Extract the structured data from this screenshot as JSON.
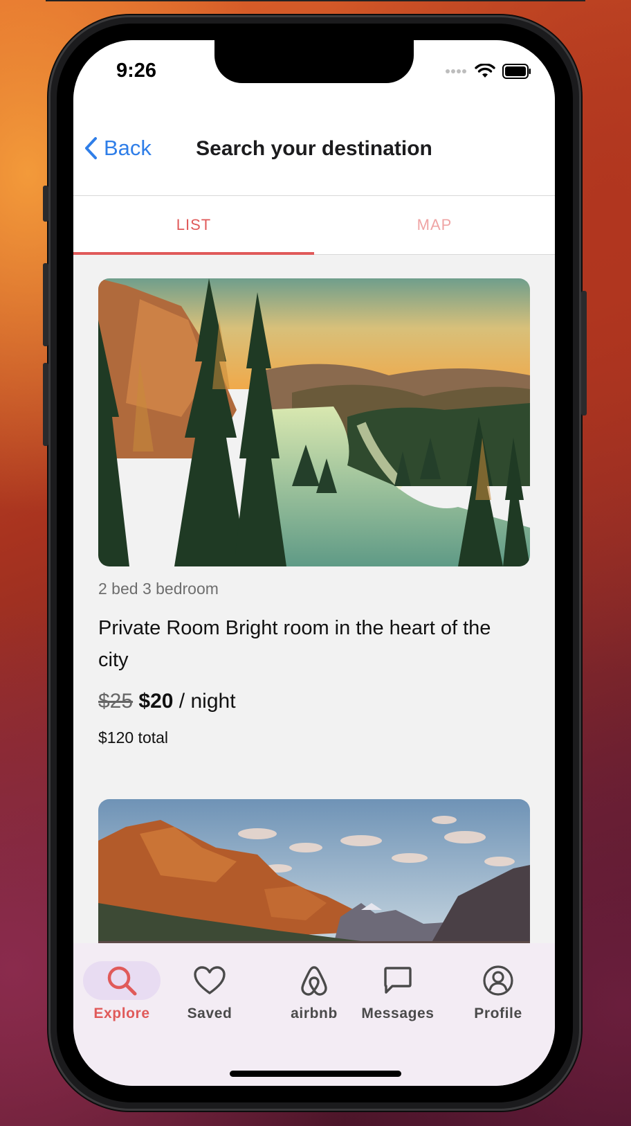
{
  "status": {
    "time": "9:26"
  },
  "nav": {
    "back_label": "Back",
    "title": "Search your destination"
  },
  "tabs": [
    {
      "label": "LIST",
      "active": true
    },
    {
      "label": "MAP",
      "active": false
    }
  ],
  "listings": [
    {
      "meta": "2 bed 3 bedroom",
      "title": "Private Room Bright room in the heart of the city",
      "old_price": "$25",
      "new_price": "$20",
      "per": " / night",
      "total": "$120 total"
    }
  ],
  "bottom_tabs": [
    {
      "label": "Explore",
      "icon": "search-icon",
      "active": true
    },
    {
      "label": "Saved",
      "icon": "heart-icon",
      "active": false
    },
    {
      "label": "airbnb",
      "icon": "airbnb-logo-icon",
      "active": false
    },
    {
      "label": "Messages",
      "icon": "message-icon",
      "active": false
    },
    {
      "label": "Profile",
      "icon": "profile-icon",
      "active": false
    }
  ],
  "colors": {
    "accent": "#e05a5a",
    "link": "#2f7ee8",
    "tab_bar_bg": "#f3ecf4"
  }
}
